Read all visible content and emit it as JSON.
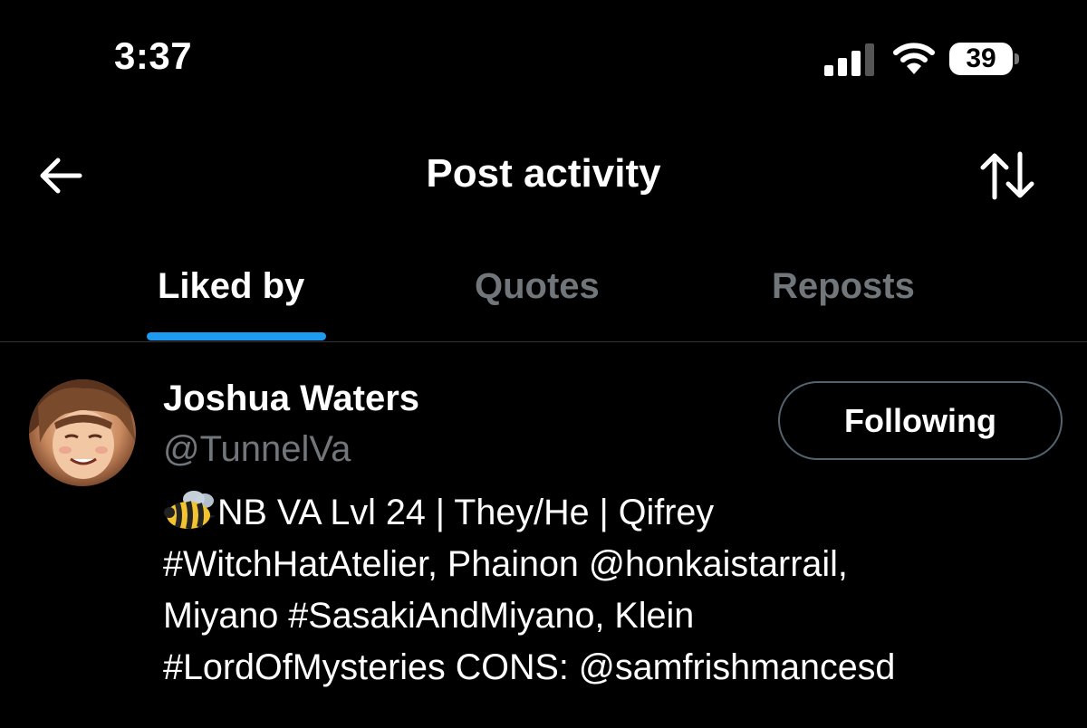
{
  "status_bar": {
    "time": "3:37",
    "battery": "39"
  },
  "header": {
    "title": "Post activity",
    "back_icon": "arrow-left-icon",
    "sort_icon": "sort-arrows-icon"
  },
  "tabs": [
    {
      "label": "Liked by",
      "active": true
    },
    {
      "label": "Quotes",
      "active": false
    },
    {
      "label": "Reposts",
      "active": false
    }
  ],
  "user": {
    "name": "Joshua Waters",
    "handle": "@TunnelVa",
    "follow_label": "Following",
    "bio_emoji": "bee-emoji",
    "bio_lines": [
      "NB VA Lvl 24 | They/He | Qifrey",
      "#WitchHatAtelier, Phainon @honkaistarrail,",
      "Miyano #SasakiAndMiyano, Klein",
      "#LordOfMysteries CONS: @samfrishmancesd"
    ]
  },
  "colors": {
    "background": "#000000",
    "accent": "#1d9bf0",
    "secondary_text": "#71767b",
    "divider": "#2f3336"
  }
}
